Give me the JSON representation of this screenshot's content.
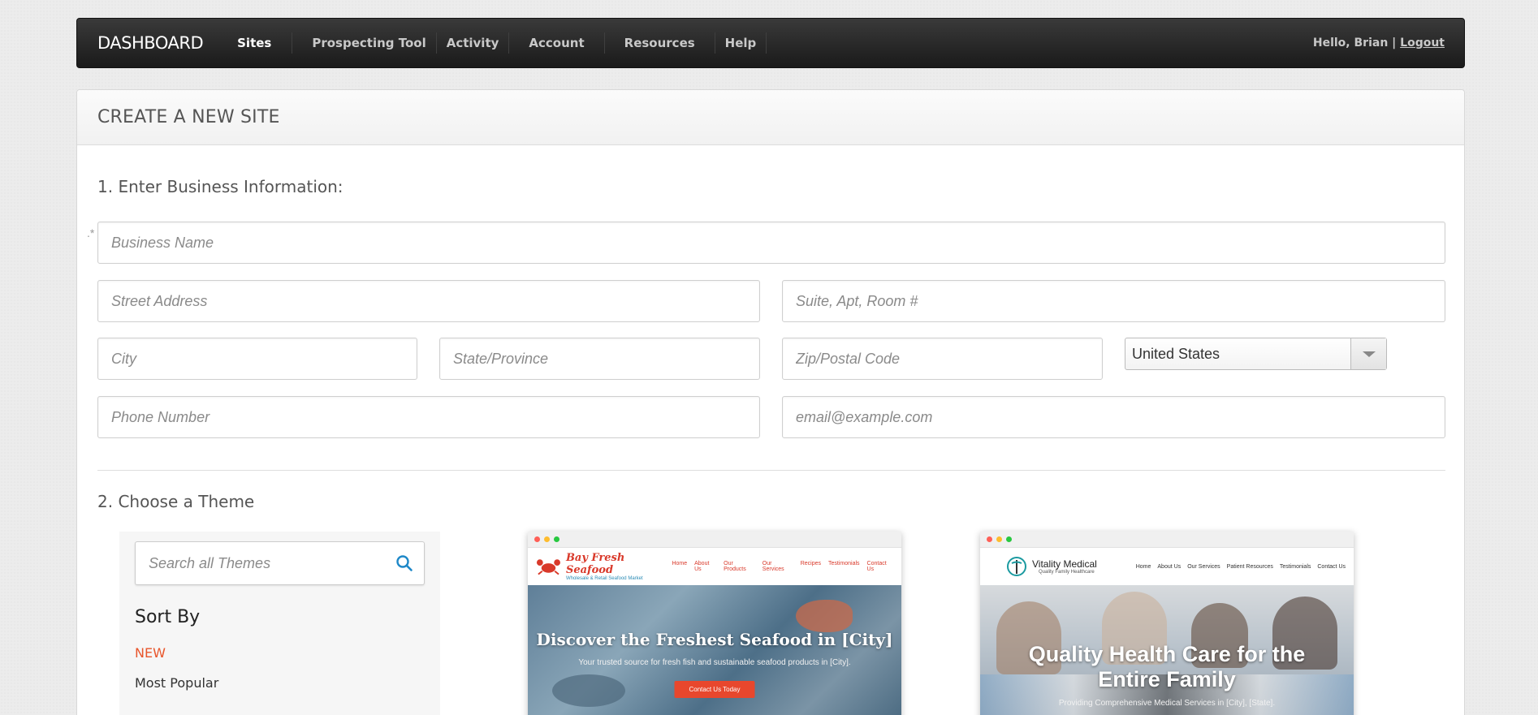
{
  "nav": {
    "brand": "DASHBOARD",
    "items": [
      {
        "label": "Sites"
      },
      {
        "label": "Prospecting Tool"
      },
      {
        "label": "Activity"
      },
      {
        "label": "Account"
      },
      {
        "label": "Resources"
      },
      {
        "label": "Help"
      }
    ],
    "greeting": "Hello, Brian |",
    "logout": "Logout"
  },
  "panel": {
    "title": "CREATE A NEW SITE",
    "section1": "1. Enter Business Information:",
    "required_mark": ".*",
    "fields": {
      "business_name": "Business Name",
      "street": "Street Address",
      "suite": "Suite, Apt, Room #",
      "city": "City",
      "state": "State/Province",
      "zip": "Zip/Postal Code",
      "country": "United States",
      "phone": "Phone Number",
      "email": "email@example.com"
    },
    "section2": "2. Choose a Theme"
  },
  "themes": {
    "search_placeholder": "Search all Themes",
    "sort_by": "Sort By",
    "sort_new": "NEW",
    "sort_popular": "Most Popular",
    "cards": [
      {
        "logo_title": "Bay Fresh Seafood",
        "logo_sub": "Wholesale & Retail Seafood Market",
        "links": [
          "Home",
          "About Us",
          "Our Products",
          "Our Services",
          "Recipes",
          "Testimonials",
          "Contact Us"
        ],
        "hero_title": "Discover the Freshest Seafood in [City]",
        "hero_sub": "Your trusted source for fresh fish and sustainable seafood products in [City].",
        "cta": "Contact Us Today"
      },
      {
        "logo_title": "Vitality Medical",
        "logo_sub": "Quality Family Healthcare",
        "links": [
          "Home",
          "About Us",
          "Our Services",
          "Patient Resources",
          "Testimonials",
          "Contact Us"
        ],
        "hero_title": "Quality Health Care for the Entire Family",
        "hero_sub": "Providing Comprehensive Medical Services in [City], [State]."
      }
    ]
  },
  "colors": {
    "accent": "#e8552b",
    "link_blue": "#1e88c8"
  }
}
